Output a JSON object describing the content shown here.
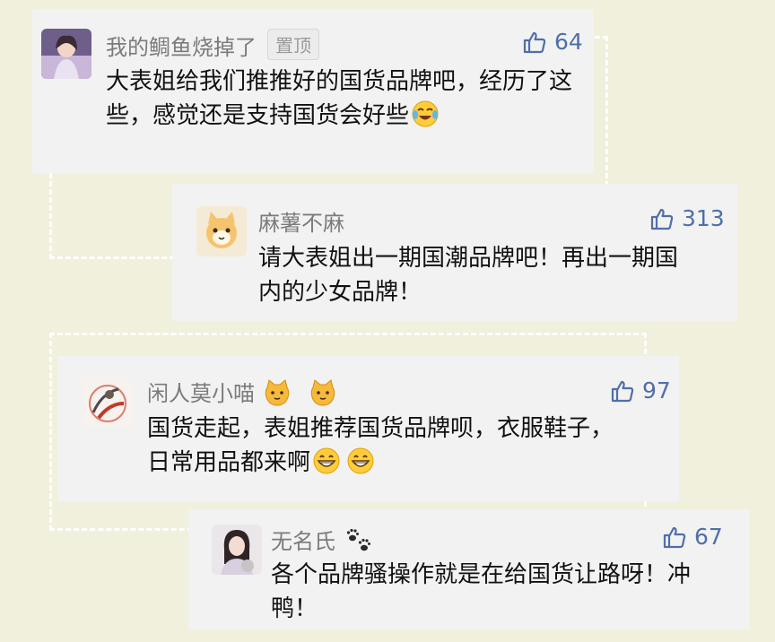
{
  "comments": [
    {
      "username": "我的鲷鱼烧掉了",
      "badge": "置顶",
      "likes": "64",
      "text": "大表姐给我们推推好的国货品牌吧，经历了这些，感觉还是支持国货会好些",
      "emojis": [
        "laughing-crying-emoji"
      ],
      "avatar": "woman-portrait-avatar"
    },
    {
      "username": "麻薯不麻",
      "likes": "313",
      "text": "请大表姐出一期国潮品牌吧！再出一期国内的少女品牌！",
      "avatar": "cartoon-cat-avatar"
    },
    {
      "username": "闲人莫小喵",
      "username_emojis": [
        "cat-face-emoji",
        "cat-face-emoji"
      ],
      "likes": "97",
      "text": "国货走起，表姐推荐国货品牌呗，衣服鞋子，日常用品都来啊",
      "emojis": [
        "grinning-emoji",
        "grinning-emoji"
      ],
      "avatar": "ink-painting-avatar"
    },
    {
      "username": "无名氏",
      "username_emojis": [
        "paw-prints-emoji"
      ],
      "likes": "67",
      "text": "各个品牌骚操作就是在给国货让路呀！冲鸭！",
      "avatar": "girl-with-cat-avatar"
    }
  ],
  "colors": {
    "background": "#f0f0dc",
    "card": "#f2f2f2",
    "like": "#4f6fa8",
    "username": "#7b7b7b"
  }
}
